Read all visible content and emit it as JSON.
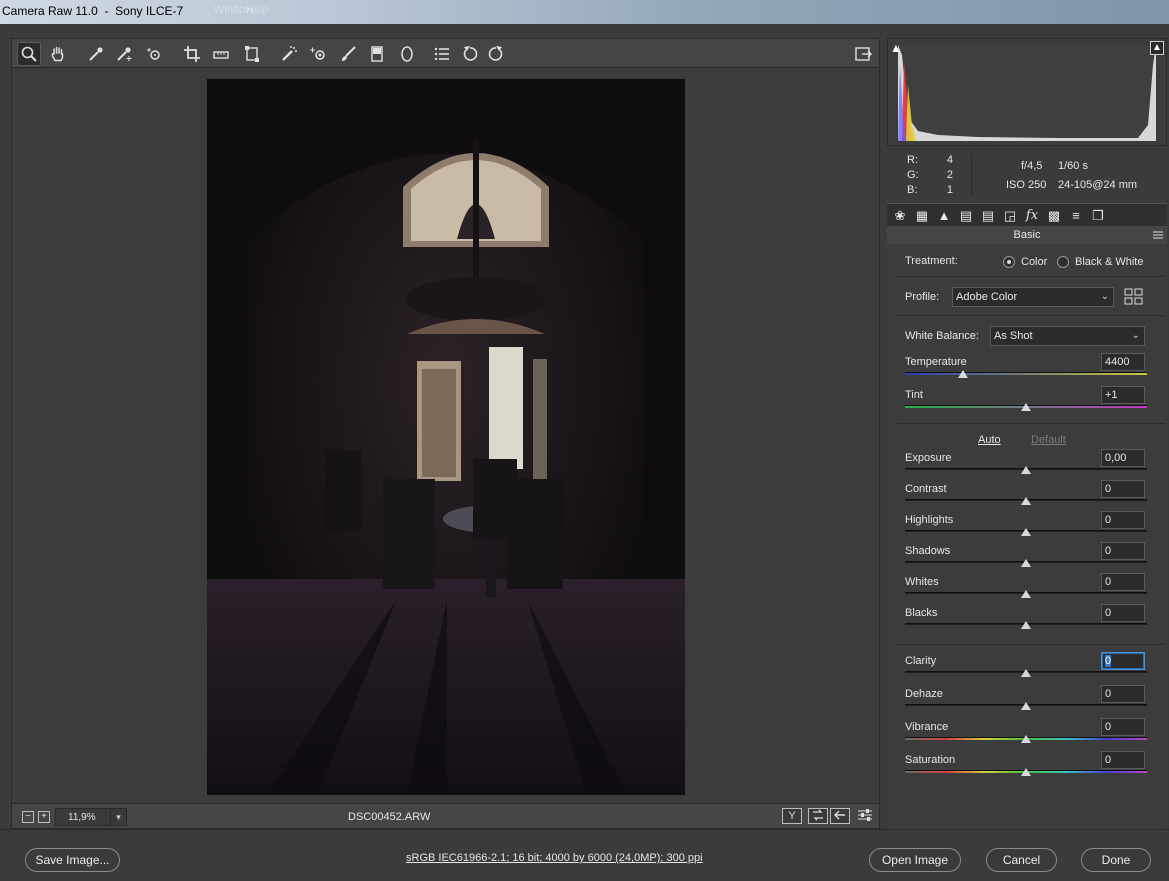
{
  "window": {
    "title": "Camera Raw 11.0  -  Sony ILCE-7",
    "ghost_menu_1": "Window",
    "ghost_menu_2": "Help"
  },
  "toolbar": {
    "tools": [
      {
        "name": "zoom-tool",
        "icon": "magnifier-icon"
      },
      {
        "name": "hand-tool",
        "icon": "hand-icon"
      },
      {
        "name": "white-balance-tool",
        "icon": "eyedropper-icon"
      },
      {
        "name": "color-sampler-tool",
        "icon": "color-sampler-icon"
      },
      {
        "name": "targeted-adjustment-tool",
        "icon": "target-adjust-icon"
      },
      {
        "name": "crop-tool",
        "icon": "crop-icon"
      },
      {
        "name": "straighten-tool",
        "icon": "level-icon"
      },
      {
        "name": "transform-tool",
        "icon": "transform-icon"
      },
      {
        "name": "spot-removal-tool",
        "icon": "spot-removal-icon"
      },
      {
        "name": "red-eye-tool",
        "icon": "red-eye-icon"
      },
      {
        "name": "adjustment-brush-tool",
        "icon": "brush-icon"
      },
      {
        "name": "graduated-filter-tool",
        "icon": "graduated-filter-icon"
      },
      {
        "name": "radial-filter-tool",
        "icon": "radial-filter-icon"
      },
      {
        "name": "preferences-tool",
        "icon": "list-icon"
      },
      {
        "name": "rotate-left-tool",
        "icon": "rotate-ccw-icon"
      },
      {
        "name": "rotate-right-tool",
        "icon": "rotate-cw-icon"
      }
    ]
  },
  "status": {
    "zoom_value": "11,9%",
    "filename": "DSC00452.ARW",
    "minus": "−",
    "plus": "+",
    "view_y": "Y"
  },
  "readout": {
    "r_label": "R:",
    "r_value": "4",
    "g_label": "G:",
    "g_value": "2",
    "b_label": "B:",
    "b_value": "1",
    "aperture": "f/4,5",
    "shutter": "1/60 s",
    "iso": "ISO 250",
    "lens": "24-105@24 mm"
  },
  "panel": {
    "title": "Basic",
    "treatment_label": "Treatment:",
    "treatment_color": "Color",
    "treatment_bw": "Black & White",
    "profile_label": "Profile:",
    "profile_value": "Adobe Color",
    "wb_label": "White Balance:",
    "wb_value": "As Shot",
    "auto": "Auto",
    "default": "Default",
    "sliders": [
      {
        "label": "Temperature",
        "value": "4400",
        "position": 0.24
      },
      {
        "label": "Tint",
        "value": "+1",
        "position": 0.5
      },
      {
        "label": "Exposure",
        "value": "0,00",
        "position": 0.5
      },
      {
        "label": "Contrast",
        "value": "0",
        "position": 0.5
      },
      {
        "label": "Highlights",
        "value": "0",
        "position": 0.5
      },
      {
        "label": "Shadows",
        "value": "0",
        "position": 0.5
      },
      {
        "label": "Whites",
        "value": "0",
        "position": 0.5
      },
      {
        "label": "Blacks",
        "value": "0",
        "position": 0.5
      },
      {
        "label": "Clarity",
        "value": "0",
        "position": 0.5
      },
      {
        "label": "Dehaze",
        "value": "0",
        "position": 0.5
      },
      {
        "label": "Vibrance",
        "value": "0",
        "position": 0.5
      },
      {
        "label": "Saturation",
        "value": "0",
        "position": 0.5
      }
    ]
  },
  "bottom": {
    "save_label": "Save Image...",
    "workflow_link": "sRGB IEC61966-2.1; 16 bit; 4000 by 6000 (24,0MP); 300 ppi",
    "open_label": "Open Image",
    "cancel_label": "Cancel",
    "done_label": "Done"
  },
  "colors": {
    "accent": "#4a90d9",
    "panel_bg": "#3c3c3c",
    "frame_bg": "#3b3b3b"
  }
}
